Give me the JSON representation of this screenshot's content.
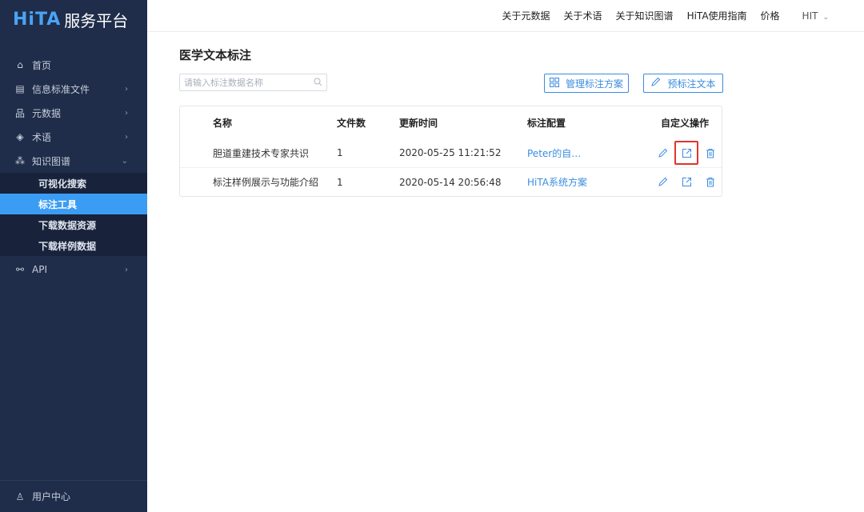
{
  "brand": {
    "logo": "HiTA",
    "name": "服务平台"
  },
  "sidebar": {
    "items": [
      {
        "icon": "home-icon",
        "glyph": "⌂",
        "label": "首页",
        "arrow": ""
      },
      {
        "icon": "document-icon",
        "glyph": "▤",
        "label": "信息标准文件",
        "arrow": "›"
      },
      {
        "icon": "hierarchy-icon",
        "glyph": "品",
        "label": "元数据",
        "arrow": "›"
      },
      {
        "icon": "eye-icon",
        "glyph": "◈",
        "label": "术语",
        "arrow": "›"
      },
      {
        "icon": "graph-icon",
        "glyph": "⁂",
        "label": "知识图谱",
        "arrow": "⌄"
      }
    ],
    "submenu": [
      {
        "label": "可视化搜索",
        "active": false
      },
      {
        "label": "标注工具",
        "active": true
      },
      {
        "label": "下载数据资源",
        "active": false
      },
      {
        "label": "下载样例数据",
        "active": false
      }
    ],
    "api": {
      "icon": "link-icon",
      "glyph": "⚯",
      "label": "API",
      "arrow": "›"
    },
    "bottom": {
      "icon": "user-icon",
      "glyph": "♙",
      "label": "用户中心"
    }
  },
  "topnav": {
    "links": [
      "关于元数据",
      "关于术语",
      "关于知识图谱",
      "HiTA使用指南",
      "价格"
    ],
    "user": "HIT",
    "user_chevron": "⌄"
  },
  "main": {
    "title": "医学文本标注",
    "search_placeholder": "请输入标注数据名称",
    "manage_button": "管理标注方案",
    "preannotate_button": "预标注文本",
    "table": {
      "headers": {
        "name": "名称",
        "files": "文件数",
        "time": "更新时间",
        "config": "标注配置",
        "ops": "自定义操作"
      },
      "rows": [
        {
          "name": "胆道重建技术专家共识",
          "files": "1",
          "time": "2020-05-25 11:21:52",
          "config": "Peter的自…"
        },
        {
          "name": "标注样例展示与功能介绍",
          "files": "1",
          "time": "2020-05-14 20:56:48",
          "config": "HiTA系统方案"
        }
      ]
    }
  },
  "colors": {
    "sidebar_bg": "#1f2d4a",
    "accent": "#3b8de0",
    "active_bg": "#3b9cf3",
    "highlight_box": "#e0352b"
  }
}
